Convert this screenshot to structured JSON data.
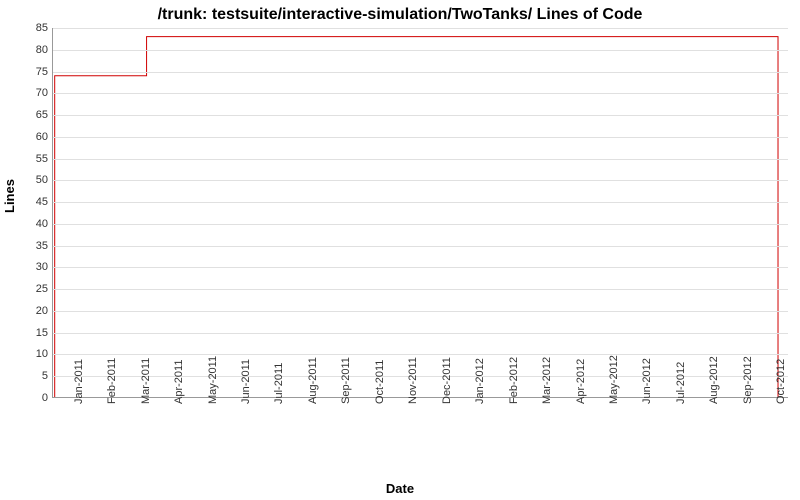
{
  "chart_data": {
    "type": "line",
    "title": "/trunk: testsuite/interactive-simulation/TwoTanks/ Lines of Code",
    "xlabel": "Date",
    "ylabel": "Lines",
    "ylim": [
      0,
      85
    ],
    "y_ticks": [
      0,
      5,
      10,
      15,
      20,
      25,
      30,
      35,
      40,
      45,
      50,
      55,
      60,
      65,
      70,
      75,
      80,
      85
    ],
    "x_categories": [
      "Jan-2011",
      "Feb-2011",
      "Mar-2011",
      "Apr-2011",
      "May-2011",
      "Jun-2011",
      "Jul-2011",
      "Aug-2011",
      "Sep-2011",
      "Oct-2011",
      "Nov-2011",
      "Dec-2011",
      "Jan-2012",
      "Feb-2012",
      "Mar-2012",
      "Apr-2012",
      "May-2012",
      "Jun-2012",
      "Jul-2012",
      "Aug-2012",
      "Sep-2012",
      "Oct-2012"
    ],
    "series": [
      {
        "name": "Lines of Code",
        "color": "#d00000",
        "points": [
          {
            "x": -0.45,
            "y": 0
          },
          {
            "x": -0.45,
            "y": 74
          },
          {
            "x": 2.3,
            "y": 74
          },
          {
            "x": 2.3,
            "y": 83
          },
          {
            "x": 21.2,
            "y": 83
          },
          {
            "x": 21.2,
            "y": 0
          }
        ]
      }
    ]
  }
}
